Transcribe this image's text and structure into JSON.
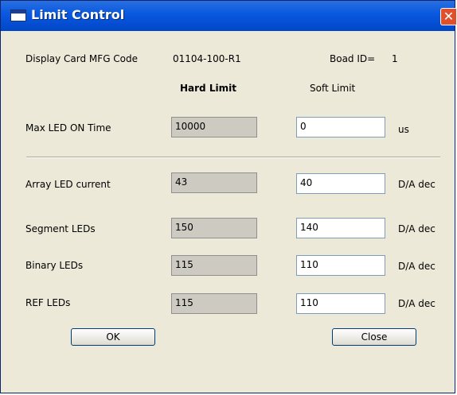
{
  "window": {
    "title": "Limit Control",
    "close_glyph": "✕"
  },
  "info": {
    "mfg_label": "Display Card MFG Code",
    "mfg_value": "01104-100-R1",
    "board_label": "Boad ID=",
    "board_value": "1"
  },
  "headers": {
    "hard": "Hard Limit",
    "soft": "Soft Limit"
  },
  "rows": [
    {
      "label": "Max LED ON Time",
      "hard": "10000",
      "soft": "0",
      "unit": "us"
    },
    {
      "label": "Array LED current",
      "hard": "43",
      "soft": "40",
      "unit": "D/A dec"
    },
    {
      "label": "Segment LEDs",
      "hard": "150",
      "soft": "140",
      "unit": "D/A dec"
    },
    {
      "label": "Binary LEDs",
      "hard": "115",
      "soft": "110",
      "unit": "D/A dec"
    },
    {
      "label": "REF LEDs",
      "hard": "115",
      "soft": "110",
      "unit": "D/A dec"
    }
  ],
  "buttons": {
    "ok": "OK",
    "close": "Close"
  }
}
